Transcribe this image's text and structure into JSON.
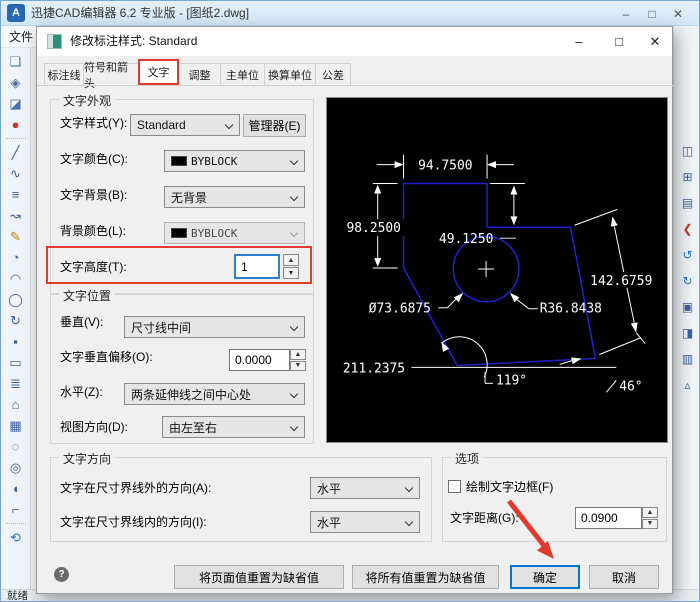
{
  "main_window": {
    "title": "迅捷CAD编辑器 6.2 专业版 - [图纸2.dwg]",
    "menu_file": "文件",
    "status": "就绪"
  },
  "icons": {
    "app_logo": "A",
    "minimize": "–",
    "maximize": "□",
    "close": "✕",
    "dialog_minimize": "–",
    "dialog_maximize": "□",
    "dialog_close": "✕",
    "spinner_up": "▲",
    "spinner_down": "▼",
    "help": "?",
    "left_toolbar": [
      {
        "name": "new-file-icon",
        "glyph": "❏",
        "color": "#4a6fa5"
      },
      {
        "name": "open-file-icon",
        "glyph": "◈",
        "color": "#4a6fa5"
      },
      {
        "name": "eraser-icon",
        "glyph": "◪",
        "color": "#4a6fa5"
      },
      {
        "name": "render-sphere-icon",
        "glyph": "●",
        "color": "#c0392b"
      },
      {
        "sep": true
      },
      {
        "name": "line-icon",
        "glyph": "╱",
        "color": "#3a5f9f"
      },
      {
        "name": "spline-icon",
        "glyph": "∿",
        "color": "#3a5f9f"
      },
      {
        "name": "multiline-icon",
        "glyph": "≡",
        "color": "#3a5f9f"
      },
      {
        "name": "polyline-icon",
        "glyph": "↝",
        "color": "#3a5f9f"
      },
      {
        "name": "sketch-icon",
        "glyph": "✎",
        "color": "#b8860b"
      },
      {
        "name": "circle-icon",
        "glyph": "◔",
        "color": "#3a5f9f"
      },
      {
        "name": "arc-icon",
        "glyph": "◠",
        "color": "#3a5f9f"
      },
      {
        "name": "ellipse-icon",
        "glyph": "◯",
        "color": "#3a5f9f"
      },
      {
        "name": "rotate-icon",
        "glyph": "↻",
        "color": "#3a5f9f"
      },
      {
        "name": "point-icon",
        "glyph": "▪",
        "color": "#3a5f9f"
      },
      {
        "name": "rectangle-icon",
        "glyph": "▭",
        "color": "#3a5f9f"
      },
      {
        "name": "hatch-lines-icon",
        "glyph": "≣",
        "color": "#3a5f9f"
      },
      {
        "name": "polygon-icon",
        "glyph": "⌂",
        "color": "#3a5f9f"
      },
      {
        "name": "region-icon",
        "glyph": "▦",
        "color": "#3a5f9f"
      },
      {
        "name": "revision-cloud-icon",
        "glyph": "◌",
        "color": "#3a5f9f"
      },
      {
        "name": "donut-icon",
        "glyph": "◎",
        "color": "#3a5f9f"
      },
      {
        "name": "callout-icon",
        "glyph": "◖",
        "color": "#3a5f9f"
      },
      {
        "name": "fillet-icon",
        "glyph": "⌐",
        "color": "#3a5f9f"
      },
      {
        "sep": true
      },
      {
        "name": "sync-icon",
        "glyph": "⟲",
        "color": "#1a73c8"
      }
    ],
    "right_toolbar": [
      {
        "name": "pan-icon",
        "glyph": "◫",
        "color": "#3a5f9f"
      },
      {
        "name": "zoom-window-icon",
        "glyph": "⊞",
        "color": "#3a5f9f"
      },
      {
        "name": "layers-icon",
        "glyph": "▤",
        "color": "#3a5f9f"
      },
      {
        "name": "previous-view-icon",
        "glyph": "❮",
        "color": "#c0392b"
      },
      {
        "name": "undo-icon",
        "glyph": "↺",
        "color": "#1a73c8"
      },
      {
        "name": "redo-icon",
        "glyph": "↻",
        "color": "#1a73c8"
      },
      {
        "name": "measure-icon",
        "glyph": "▣",
        "color": "#3a5f9f"
      },
      {
        "name": "annotate-icon",
        "glyph": "◨",
        "color": "#3a5f9f"
      },
      {
        "name": "layout-icon",
        "glyph": "▥",
        "color": "#3a5f9f"
      },
      {
        "name": "settings-icon",
        "glyph": "▵",
        "color": "#3a5f9f"
      }
    ]
  },
  "dialog": {
    "title": "修改标注样式: Standard",
    "tabs": [
      "标注线",
      "符号和箭头",
      "文字",
      "调整",
      "主单位",
      "换算单位",
      "公差"
    ],
    "active_tab": "文字",
    "text_appearance": {
      "group_title": "文字外观",
      "text_style_label": "文字样式(Y):",
      "text_style_value": "Standard",
      "manager_button": "管理器(E)",
      "text_color_label": "文字颜色(C):",
      "text_color_value": "BYBLOCK",
      "fill_color_label": "文字背景(B):",
      "fill_color_value": "无背景",
      "bg_color_label": "背景颜色(L):",
      "bg_color_value": "BYBLOCK",
      "text_height_label": "文字高度(T):",
      "text_height_value": "1"
    },
    "text_position": {
      "group_title": "文字位置",
      "vertical_label": "垂直(V):",
      "vertical_value": "尺寸线中间",
      "offset_label": "文字垂直偏移(O):",
      "offset_value": "0.0000",
      "horizontal_label": "水平(Z):",
      "horizontal_value": "两条延伸线之间中心处",
      "view_direction_label": "视图方向(D):",
      "view_direction_value": "由左至右"
    },
    "text_alignment": {
      "group_title": "文字方向",
      "outside_label": "文字在尺寸界线外的方向(A):",
      "outside_value": "水平",
      "inside_label": "文字在尺寸界线内的方向(I):",
      "inside_value": "水平"
    },
    "options": {
      "group_title": "选项",
      "draw_frame_label": "绘制文字边框(F)",
      "text_gap_label": "文字距离(G):",
      "text_gap_value": "0.0900"
    },
    "buttons": {
      "reset_page": "将页面值重置为缺省值",
      "reset_all": "将所有值重置为缺省值",
      "ok": "确定",
      "cancel": "取消"
    },
    "preview": {
      "dim_top": "94.7500",
      "dim_left": "98.2500",
      "dim_step": "49.1250",
      "dim_slant": "142.6759",
      "dim_diameter": "Ø73.6875",
      "dim_radius": "R36.8438",
      "dim_bottom": "211.2375",
      "dim_angle1": "119°",
      "dim_angle2": "46°"
    },
    "colors": {
      "highlight_red": "#e23a2e",
      "focus_blue": "#0078d7",
      "preview_blue": "#2121cc"
    }
  }
}
